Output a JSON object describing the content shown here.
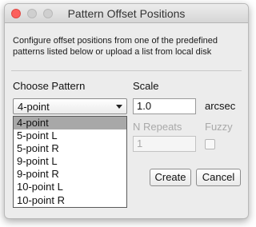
{
  "window": {
    "title": "Pattern Offset Positions"
  },
  "intro_text": "Configure offset positions from one of the predefined patterns listed below or upload a list from local disk",
  "choose_pattern": {
    "label": "Choose Pattern",
    "selected": "4-point",
    "options": [
      "4-point",
      "5-point L",
      "5-point R",
      "9-point L",
      "9-point R",
      "10-point L",
      "10-point R"
    ]
  },
  "scale": {
    "label": "Scale",
    "value": "1.0",
    "unit": "arcsec"
  },
  "repeats": {
    "label": "N Repeats",
    "value": "1"
  },
  "fuzzy": {
    "label": "Fuzzy"
  },
  "buttons": {
    "create": "Create",
    "cancel": "Cancel"
  },
  "colors": {
    "close_button": "#fc605c",
    "selected_option_bg": "#a8a8a8"
  }
}
